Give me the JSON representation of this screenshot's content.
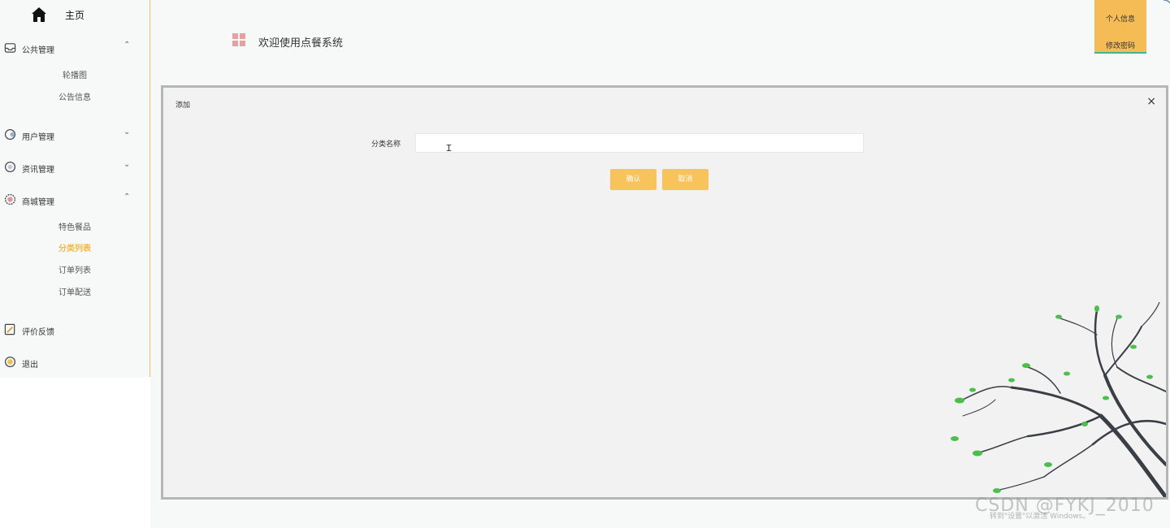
{
  "sidebar": {
    "home_label": "主页",
    "menus": [
      {
        "label": "公共管理",
        "chevron": "⌃",
        "icon": "inbox-icon"
      },
      {
        "label": "用户管理",
        "chevron": "⌄",
        "icon": "circle-icon"
      },
      {
        "label": "资讯管理",
        "chevron": "⌄",
        "icon": "circle-icon"
      },
      {
        "label": "商城管理",
        "chevron": "⌃",
        "icon": "gear-icon"
      },
      {
        "label": "评价反馈",
        "icon": "feedback-icon"
      },
      {
        "label": "退出",
        "icon": "exit-icon"
      }
    ],
    "public_sub": [
      "轮播图",
      "公告信息"
    ],
    "shop_sub": [
      "特色餐品",
      "分类列表",
      "订单列表",
      "订单配送"
    ]
  },
  "header": {
    "title": "欢迎使用点餐系统",
    "user_menu": [
      "个人信息",
      "修改密码"
    ]
  },
  "modal": {
    "title": "添加",
    "close": "×",
    "field_label": "分类名称",
    "field_value": "",
    "confirm": "确认",
    "cancel": "取消"
  },
  "watermark": "CSDN @FYKJ_2010",
  "activation_text": "转到\"设置\"以激活 Windows。",
  "colors": {
    "accent": "#f7c35a",
    "active_menu": "#f3b93f",
    "underline": "#45b38e"
  }
}
